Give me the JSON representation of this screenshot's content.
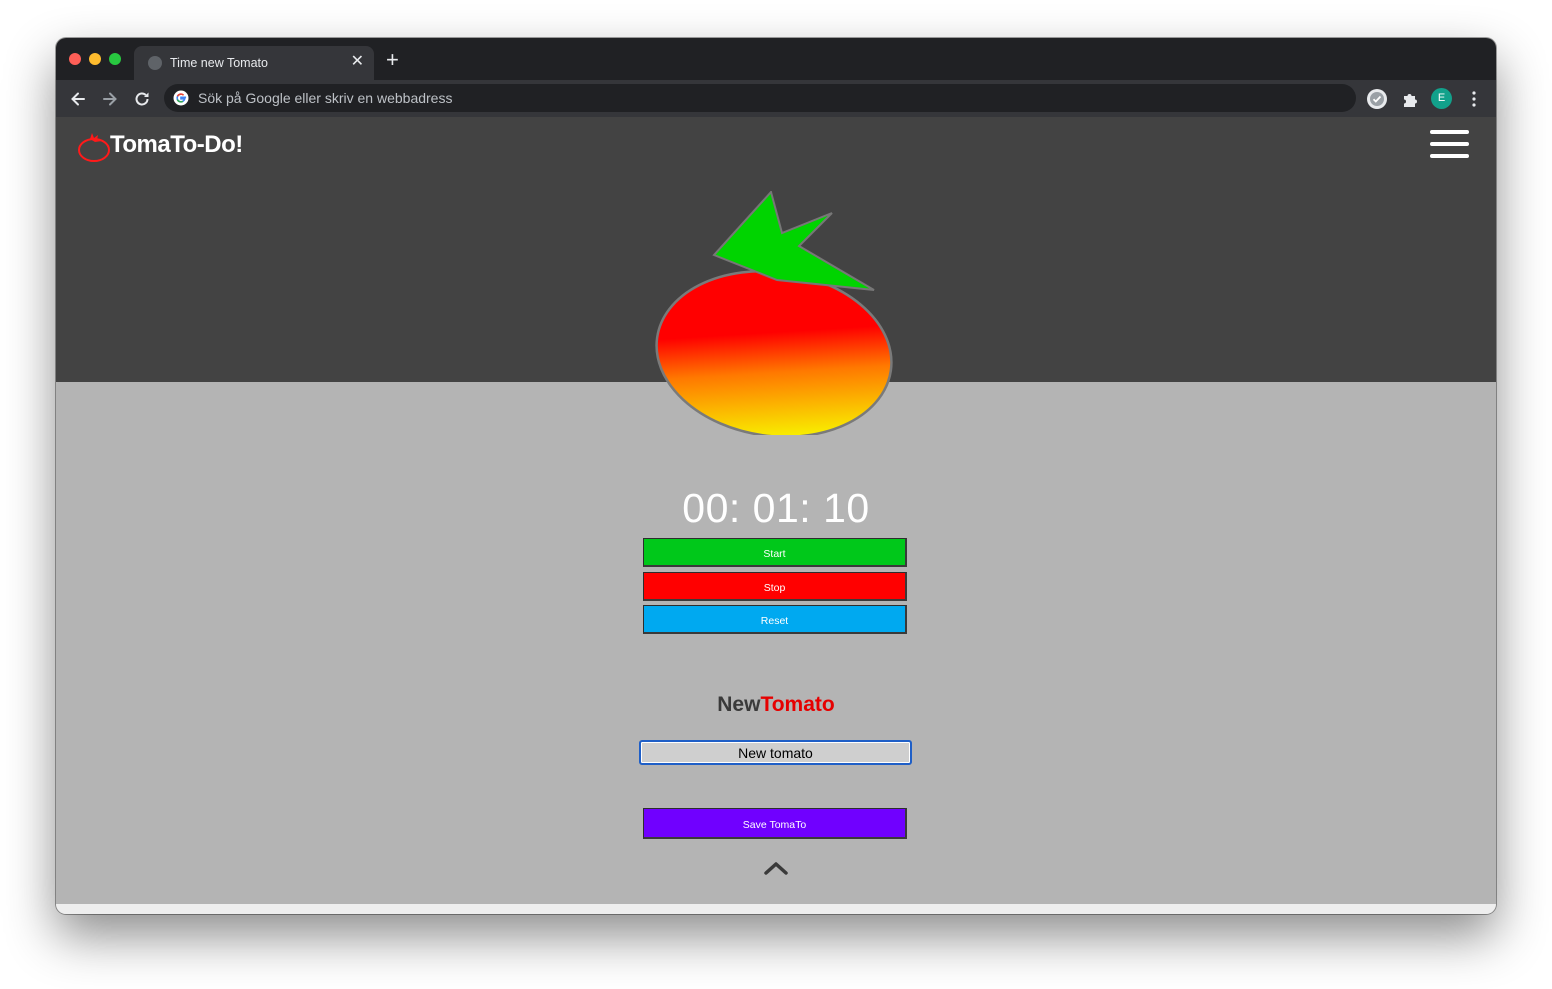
{
  "browser": {
    "tab_title": "Time new Tomato",
    "tab_close": "✕",
    "new_tab": "+",
    "address_placeholder": "Sök på Google eller skriv en webbadress",
    "profile_initial": "E"
  },
  "app": {
    "brand": "TomaTo-Do!",
    "timer": "00: 01: 10",
    "buttons": {
      "start": "Start",
      "stop": "Stop",
      "reset": "Reset",
      "save": "Save TomaTo"
    },
    "form": {
      "heading_part1": "New",
      "heading_part2": "Tomato",
      "input_value": "New tomato"
    }
  },
  "colors": {
    "hero_bg": "#434343",
    "page_bg": "#b4b4b4",
    "start": "#00c81a",
    "stop": "#ff0000",
    "reset": "#00a9f0",
    "save": "#7000ff",
    "accent_red": "#e60000",
    "leaf_green": "#00d400"
  },
  "icons": [
    "back-arrow-icon",
    "forward-arrow-icon",
    "reload-icon",
    "google-icon",
    "extension-check-icon",
    "puzzle-icon",
    "kebab-menu-icon",
    "tomato-logo-icon",
    "hamburger-menu-icon",
    "tomato-illustration",
    "chevron-up-icon"
  ]
}
